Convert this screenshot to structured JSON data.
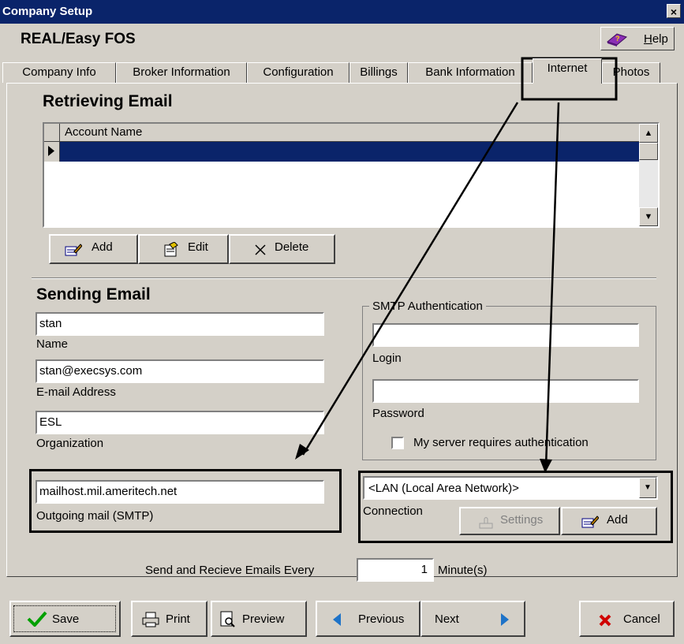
{
  "window": {
    "title": "Company Setup",
    "close_label": "×"
  },
  "app": {
    "name": "REAL/Easy FOS",
    "help_label": "Help"
  },
  "tabs": [
    {
      "label": "Company Info"
    },
    {
      "label": "Broker Information"
    },
    {
      "label": "Configuration"
    },
    {
      "label": "Billings"
    },
    {
      "label": "Bank Information"
    },
    {
      "label": "Internet"
    },
    {
      "label": "Photos"
    }
  ],
  "active_tab": "Internet",
  "retrieving": {
    "heading": "Retrieving Email",
    "column_header": "Account Name",
    "add_label": "Add",
    "edit_label": "Edit",
    "delete_label": "Delete"
  },
  "sending": {
    "heading": "Sending Email",
    "name_value": "stan",
    "name_label": "Name",
    "email_value": "stan@execsys.com",
    "email_label": "E-mail Address",
    "org_value": "ESL",
    "org_label": "Organization",
    "smtp_value": "mailhost.mil.ameritech.net",
    "smtp_label": "Outgoing mail (SMTP)"
  },
  "smtp_auth": {
    "title": "SMTP Authentication",
    "login_value": "",
    "login_label": "Login",
    "password_value": "",
    "password_label": "Password",
    "requires_auth_label": "My server requires authentication",
    "requires_auth_checked": false
  },
  "connection": {
    "value": "<LAN (Local Area Network)>",
    "label": "Connection",
    "settings_label": "Settings",
    "add_label": "Add"
  },
  "schedule": {
    "label": "Send and Recieve Emails Every",
    "value": "1",
    "unit": "Minute(s)"
  },
  "bottom": {
    "save": "Save",
    "print": "Print",
    "preview": "Preview",
    "previous": "Previous",
    "next": "Next",
    "cancel": "Cancel"
  },
  "colors": {
    "title_bar": "#0a246a",
    "face": "#d4d0c8",
    "selection": "#0a246a"
  }
}
